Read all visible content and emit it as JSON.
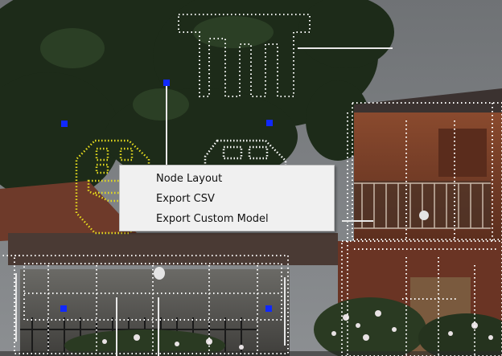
{
  "context_menu": {
    "items": [
      {
        "label": "Node Layout"
      },
      {
        "label": "Export CSV"
      },
      {
        "label": "Export Custom Model"
      }
    ]
  },
  "colors": {
    "point_cloud_white": "#ffffff",
    "face_marker_yellow": "#e6dc1e",
    "control_node_blue": "#1028ff",
    "sky": "#7a7d80",
    "tree": "#1c2a18",
    "brick": "#7a3c26",
    "menu_bg": "#f0f0f0"
  }
}
